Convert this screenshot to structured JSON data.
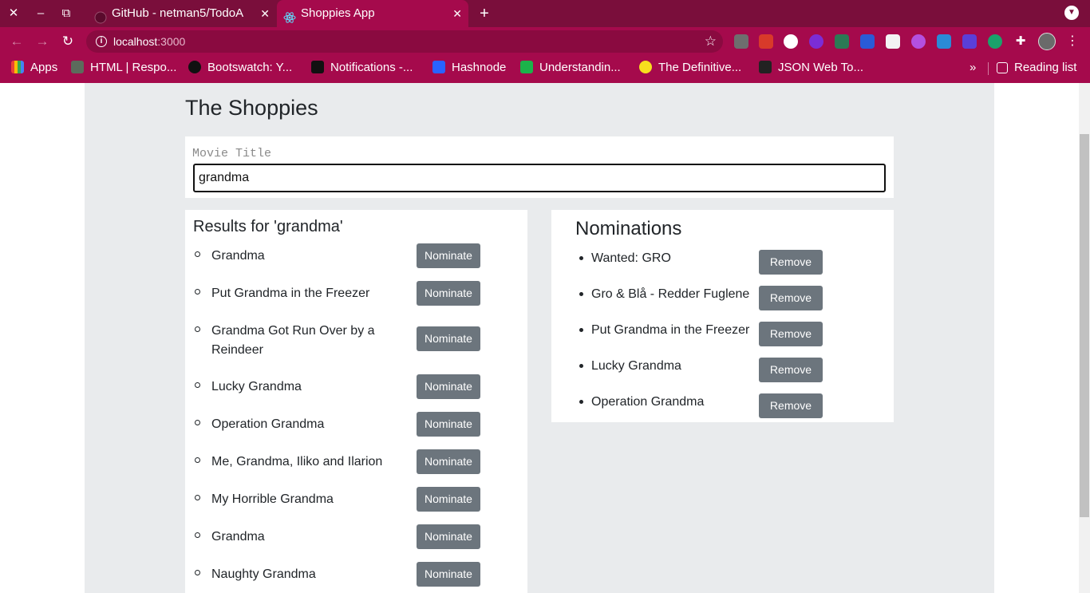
{
  "browser": {
    "tabs": [
      {
        "title": "GitHub - netman5/TodoA"
      },
      {
        "title": "Shoppies App"
      }
    ],
    "url_host": "localhost",
    "url_port": ":3000",
    "bookmarks": [
      {
        "label": "Apps"
      },
      {
        "label": "HTML | Respo..."
      },
      {
        "label": "Bootswatch: Y..."
      },
      {
        "label": "Notifications -..."
      },
      {
        "label": "Hashnode"
      },
      {
        "label": "Understandin..."
      },
      {
        "label": "The Definitive..."
      },
      {
        "label": "JSON Web To..."
      }
    ],
    "bookmarks_more": "»",
    "reading_list": "Reading list",
    "colors": {
      "frame": "#7a0e3b",
      "toolbar": "#a50a4c"
    }
  },
  "page": {
    "title": "The Shoppies",
    "search": {
      "label": "Movie Title",
      "value": "grandma"
    },
    "results": {
      "heading": "Results for 'grandma'",
      "button_label": "Nominate",
      "items": [
        {
          "title": "Grandma"
        },
        {
          "title": "Put Grandma in the Freezer"
        },
        {
          "title": "Grandma Got Run Over by a Reindeer"
        },
        {
          "title": "Lucky Grandma"
        },
        {
          "title": "Operation Grandma"
        },
        {
          "title": "Me, Grandma, Iliko and Ilarion"
        },
        {
          "title": "My Horrible Grandma"
        },
        {
          "title": "Grandma"
        },
        {
          "title": "Naughty Grandma"
        }
      ]
    },
    "nominations": {
      "heading": "Nominations",
      "button_label": "Remove",
      "items": [
        {
          "title": "Wanted: GRO"
        },
        {
          "title": "Gro & Blå - Redder Fuglene"
        },
        {
          "title": "Put Grandma in the Freezer"
        },
        {
          "title": "Lucky Grandma"
        },
        {
          "title": "Operation Grandma"
        }
      ]
    },
    "colors": {
      "button": "#6c757d",
      "background": "#e9ebed"
    }
  }
}
